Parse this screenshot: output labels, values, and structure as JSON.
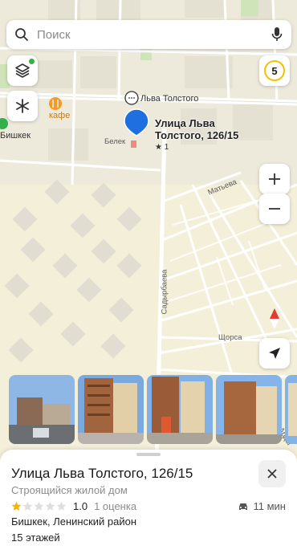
{
  "search": {
    "placeholder": "Поиск"
  },
  "map": {
    "street_top": "Льва Толстого",
    "cafe": "кафе",
    "bishkek_short": "Бишкек",
    "belek": "Белек",
    "matyeva": "Матьева",
    "sadyrbaeva": "Садырбаева",
    "shchorsa": "Щорса",
    "abdy": "Абды",
    "pin_title": "Улица Льва Толстого, 126/15",
    "pin_rating": "★ 1"
  },
  "controls": {
    "traffic_level": "5",
    "zoom_in": "+",
    "zoom_out": "−"
  },
  "place": {
    "title": "Улица Льва Толстого, 126/15",
    "type": "Строящийся жилой дом",
    "rating_value": "1.0",
    "rating_count": "1 оценка",
    "stars_filled": 1,
    "stars_total": 5,
    "drive_time": "11 мин",
    "address": "Бишкек, Ленинский район",
    "floors": "15 этажей"
  },
  "colors": {
    "accent": "#1f6fe0",
    "traffic": "#f3c300",
    "star": "#f5b400",
    "pin_marker": "#f08a7a"
  }
}
